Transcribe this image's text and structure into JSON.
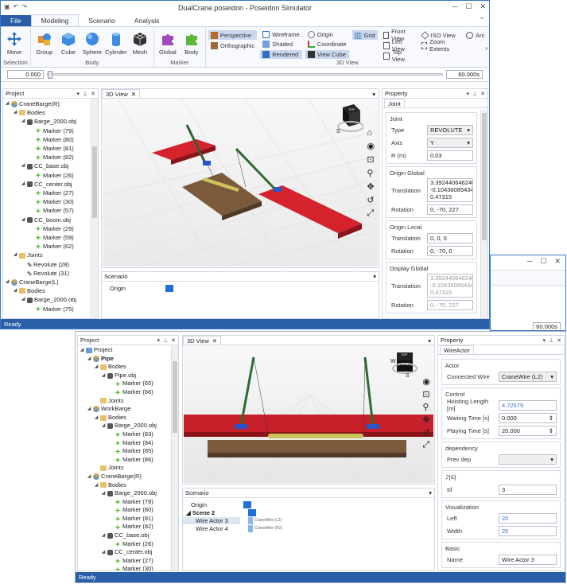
{
  "win1": {
    "title": "DualCrane.poseidon - Poseidon Simulator",
    "tabs": [
      "File",
      "Modeling",
      "Scenario",
      "Analysis"
    ],
    "ribbon": {
      "selection": {
        "label": "Selection",
        "items": [
          "Move"
        ]
      },
      "body": {
        "label": "Body",
        "items": [
          "Group",
          "Cube",
          "Sphere",
          "Cylinder",
          "Mesh"
        ]
      },
      "marker": {
        "label": "Marker",
        "items": [
          "Global",
          "Body"
        ]
      },
      "view3d": {
        "label": "3D View",
        "col1": [
          "Perspective",
          "Orthographic"
        ],
        "col2": [
          "Wireframe",
          "Shaded",
          "Rendered"
        ],
        "col3": [
          "Origin",
          "Coordinate",
          "View Cube"
        ],
        "col4": [
          "Grid"
        ],
        "col5": [
          "Front View",
          "Left View",
          "Top View"
        ],
        "col6": [
          "ISO View",
          "Zoom Extents"
        ],
        "col7": [
          "Ani"
        ]
      }
    },
    "slider": {
      "start": "0.000",
      "end": "60.000s"
    },
    "project": {
      "title": "Project",
      "tree": [
        {
          "t": "CraneBarge(R)",
          "lvl": 0,
          "ic": "barge",
          "exp": "◢"
        },
        {
          "t": "Bodies",
          "lvl": 1,
          "ic": "folder",
          "exp": "◢"
        },
        {
          "t": "Barge_2000.obj",
          "lvl": 2,
          "ic": "obj",
          "exp": "◢"
        },
        {
          "t": "Marker (79)",
          "lvl": 3,
          "ic": "marker",
          "exp": ""
        },
        {
          "t": "Marker (80)",
          "lvl": 3,
          "ic": "marker",
          "exp": ""
        },
        {
          "t": "Marker (81)",
          "lvl": 3,
          "ic": "marker",
          "exp": ""
        },
        {
          "t": "Marker (82)",
          "lvl": 3,
          "ic": "marker",
          "exp": ""
        },
        {
          "t": "CC_base.obj",
          "lvl": 2,
          "ic": "obj",
          "exp": "◢"
        },
        {
          "t": "Marker (26)",
          "lvl": 3,
          "ic": "marker",
          "exp": ""
        },
        {
          "t": "CC_center.obj",
          "lvl": 2,
          "ic": "obj",
          "exp": "◢"
        },
        {
          "t": "Marker (27)",
          "lvl": 3,
          "ic": "marker",
          "exp": ""
        },
        {
          "t": "Marker (30)",
          "lvl": 3,
          "ic": "marker",
          "exp": ""
        },
        {
          "t": "Marker (57)",
          "lvl": 3,
          "ic": "marker",
          "exp": ""
        },
        {
          "t": "CC_boom.obj",
          "lvl": 2,
          "ic": "obj",
          "exp": "◢"
        },
        {
          "t": "Marker (29)",
          "lvl": 3,
          "ic": "marker",
          "exp": ""
        },
        {
          "t": "Marker (59)",
          "lvl": 3,
          "ic": "marker",
          "exp": ""
        },
        {
          "t": "Marker (62)",
          "lvl": 3,
          "ic": "marker",
          "exp": ""
        },
        {
          "t": "Joints",
          "lvl": 1,
          "ic": "folder",
          "exp": "◢"
        },
        {
          "t": "Revolute (28)",
          "lvl": 2,
          "ic": "joint",
          "exp": ""
        },
        {
          "t": "Revolute (31)",
          "lvl": 2,
          "ic": "joint",
          "exp": ""
        },
        {
          "t": "CraneBarge(L)",
          "lvl": 0,
          "ic": "barge",
          "exp": "◢"
        },
        {
          "t": "Bodies",
          "lvl": 1,
          "ic": "folder",
          "exp": "◢"
        },
        {
          "t": "Barge_2000.obj",
          "lvl": 2,
          "ic": "obj",
          "exp": "◢"
        },
        {
          "t": "Marker (75)",
          "lvl": 3,
          "ic": "marker",
          "exp": ""
        }
      ]
    },
    "view_tab": "3D View",
    "scenario": {
      "title": "Scenario",
      "rows": [
        "Origin"
      ]
    },
    "property": {
      "title": "Property",
      "tab": "Joint",
      "joint": {
        "label": "Joint",
        "type_label": "Type",
        "type": "REVOLUTE",
        "axis_label": "Axis",
        "axis": "Y",
        "r_label": "R (m)",
        "r": "0.03"
      },
      "origin_global": {
        "label": "Origin Global",
        "translation_label": "Translation",
        "translation": [
          "3.39244064624072,",
          "-0.10436085434148",
          "0.47315"
        ],
        "rotation_label": "Rotation",
        "rotation": "0, -70, 227"
      },
      "origin_local": {
        "label": "Origin Local",
        "translation_label": "Translation",
        "translation": "0, 0, 0",
        "rotation_label": "Rotation",
        "rotation": "0, -70, 0"
      },
      "display_global": {
        "label": "Display Global",
        "translation_label": "Translation",
        "translation": [
          "3.39244064624072,",
          "-0.10436085434148",
          "0.47315"
        ],
        "rotation_label": "Rotation",
        "rotation": "0, -70, 227"
      }
    },
    "status": "Ready"
  },
  "win2bg": {
    "end": "60.000s"
  },
  "win3": {
    "project": {
      "title": "Project",
      "tree": [
        {
          "t": "Project",
          "lvl": 0,
          "ic": "proj",
          "exp": "◢",
          "b": false
        },
        {
          "t": "Pipe",
          "lvl": 1,
          "ic": "barge",
          "exp": "◢",
          "b": true
        },
        {
          "t": "Bodies",
          "lvl": 2,
          "ic": "folder",
          "exp": "◢",
          "b": false
        },
        {
          "t": "Pipe.obj",
          "lvl": 3,
          "ic": "obj",
          "exp": "◢",
          "b": false
        },
        {
          "t": "Marker (65)",
          "lvl": 4,
          "ic": "marker",
          "exp": "",
          "b": false
        },
        {
          "t": "Marker (66)",
          "lvl": 4,
          "ic": "marker",
          "exp": "",
          "b": false
        },
        {
          "t": "Joints",
          "lvl": 2,
          "ic": "folder",
          "exp": "",
          "b": false
        },
        {
          "t": "WorkBarge",
          "lvl": 1,
          "ic": "barge",
          "exp": "◢",
          "b": false
        },
        {
          "t": "Bodies",
          "lvl": 2,
          "ic": "folder",
          "exp": "◢",
          "b": false
        },
        {
          "t": "Barge_2000.obj",
          "lvl": 3,
          "ic": "obj",
          "exp": "◢",
          "b": false
        },
        {
          "t": "Marker (83)",
          "lvl": 4,
          "ic": "marker",
          "exp": "",
          "b": false
        },
        {
          "t": "Marker (84)",
          "lvl": 4,
          "ic": "marker",
          "exp": "",
          "b": false
        },
        {
          "t": "Marker (85)",
          "lvl": 4,
          "ic": "marker",
          "exp": "",
          "b": false
        },
        {
          "t": "Marker (86)",
          "lvl": 4,
          "ic": "marker",
          "exp": "",
          "b": false
        },
        {
          "t": "Joints",
          "lvl": 2,
          "ic": "folder",
          "exp": "",
          "b": false
        },
        {
          "t": "CraneBarge(R)",
          "lvl": 1,
          "ic": "barge",
          "exp": "◢",
          "b": false
        },
        {
          "t": "Bodies",
          "lvl": 2,
          "ic": "folder",
          "exp": "◢",
          "b": false
        },
        {
          "t": "Barge_2000.obj",
          "lvl": 3,
          "ic": "obj",
          "exp": "◢",
          "b": false
        },
        {
          "t": "Marker (79)",
          "lvl": 4,
          "ic": "marker",
          "exp": "",
          "b": false
        },
        {
          "t": "Marker (80)",
          "lvl": 4,
          "ic": "marker",
          "exp": "",
          "b": false
        },
        {
          "t": "Marker (81)",
          "lvl": 4,
          "ic": "marker",
          "exp": "",
          "b": false
        },
        {
          "t": "Marker (82)",
          "lvl": 4,
          "ic": "marker",
          "exp": "",
          "b": false
        },
        {
          "t": "CC_base.obj",
          "lvl": 3,
          "ic": "obj",
          "exp": "◢",
          "b": false
        },
        {
          "t": "Marker (26)",
          "lvl": 4,
          "ic": "marker",
          "exp": "",
          "b": false
        },
        {
          "t": "CC_center.obj",
          "lvl": 3,
          "ic": "obj",
          "exp": "◢",
          "b": false
        },
        {
          "t": "Marker (27)",
          "lvl": 4,
          "ic": "marker",
          "exp": "",
          "b": false
        },
        {
          "t": "Marker (30)",
          "lvl": 4,
          "ic": "marker",
          "exp": "",
          "b": false
        }
      ]
    },
    "view_tab": "3D View",
    "cube_labels": {
      "top": "TOP",
      "front": "FRONT",
      "w": "W",
      "s": "S"
    },
    "scenario": {
      "title": "Scenario",
      "origin": "Origin",
      "scene": "Scene 2",
      "wires": [
        {
          "name": "Wire Actor 3",
          "tag": "CraneWire (L2)"
        },
        {
          "name": "Wire Actor 4",
          "tag": "CraneWire (R2)"
        }
      ]
    },
    "property": {
      "title": "Property",
      "tab": "WireActor",
      "actor": {
        "label": "Actor",
        "connected_label": "Connected Wire",
        "connected": "CraneWire (L2)"
      },
      "control": {
        "label": "Control",
        "hoisting_label": "Hoisting Length [m]",
        "hoisting": "4.72679",
        "waiting_label": "Waiting Time [s]",
        "waiting": "0.000",
        "playing_label": "Playing Time [s]",
        "playing": "20.000"
      },
      "dependency": {
        "label": "dependency",
        "prev_label": "Prev dep",
        "prev": ""
      },
      "etc": {
        "label": "기타",
        "id_label": "Id",
        "id": "3"
      },
      "visualization": {
        "label": "Visualization",
        "left_label": "Left",
        "left": "20",
        "width_label": "Width",
        "width": "20"
      },
      "basic": {
        "label": "Basic",
        "name_label": "Name",
        "name": "Wire Actor 3"
      }
    },
    "status": "Ready"
  },
  "colors": {
    "accent": "#2b5ea8",
    "barge_red": "#c8202a",
    "barge_brown": "#7a5a3a",
    "scenario_blue": "#1f6fd6"
  }
}
